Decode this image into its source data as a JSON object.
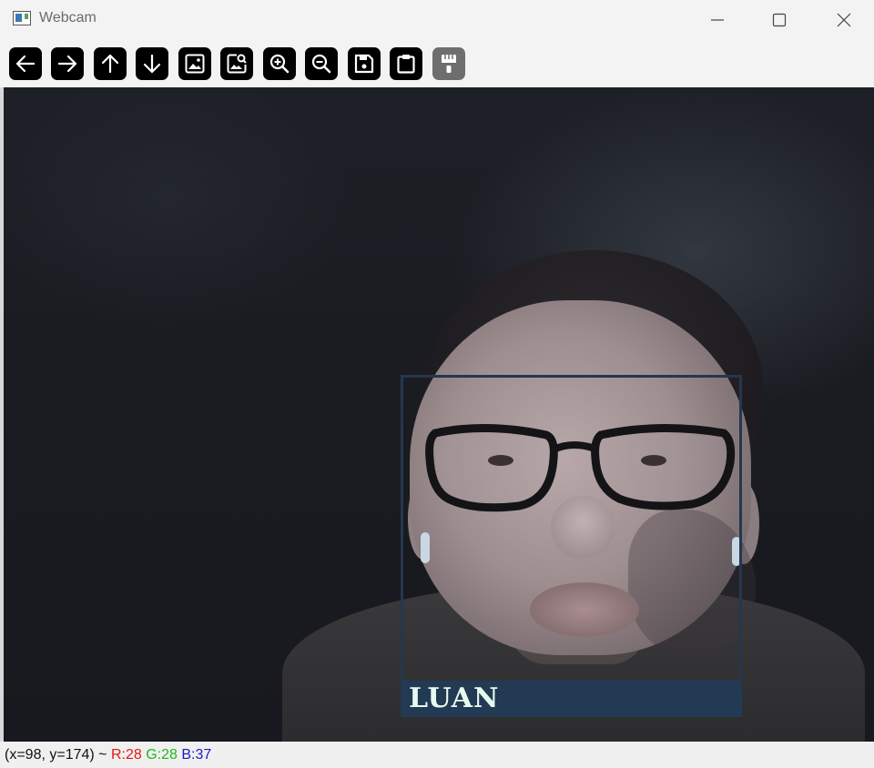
{
  "window": {
    "title": "Webcam",
    "controls": {
      "minimize": "minimize-icon",
      "maximize": "maximize-icon",
      "close": "close-icon"
    }
  },
  "toolbar": {
    "buttons": [
      {
        "name": "pan-left",
        "icon": "arrow-left-icon"
      },
      {
        "name": "pan-right",
        "icon": "arrow-right-icon"
      },
      {
        "name": "pan-up",
        "icon": "arrow-up-icon"
      },
      {
        "name": "pan-down",
        "icon": "arrow-down-icon"
      },
      {
        "name": "zoom-to-fit",
        "icon": "image-icon"
      },
      {
        "name": "zoom-actual",
        "icon": "image-search-icon"
      },
      {
        "name": "zoom-in",
        "icon": "zoom-in-icon"
      },
      {
        "name": "zoom-out",
        "icon": "zoom-out-icon"
      },
      {
        "name": "save-image",
        "icon": "save-icon"
      },
      {
        "name": "copy-clipboard",
        "icon": "clipboard-icon"
      },
      {
        "name": "properties",
        "icon": "paint-brush-icon"
      }
    ],
    "accent": "#000000",
    "disabled_color": "#6e6e6e"
  },
  "detection": {
    "label": "LUAN",
    "box_color": "#26364e",
    "label_bg": "#223a53",
    "label_text_color": "#e6fbf0"
  },
  "status": {
    "coords": "(x=98, y=174) ~",
    "r": "R:28",
    "g": "G:28",
    "b": "B:37",
    "colors": {
      "r": "#e01818",
      "g": "#1fb81f",
      "b": "#1a1ac8"
    }
  }
}
